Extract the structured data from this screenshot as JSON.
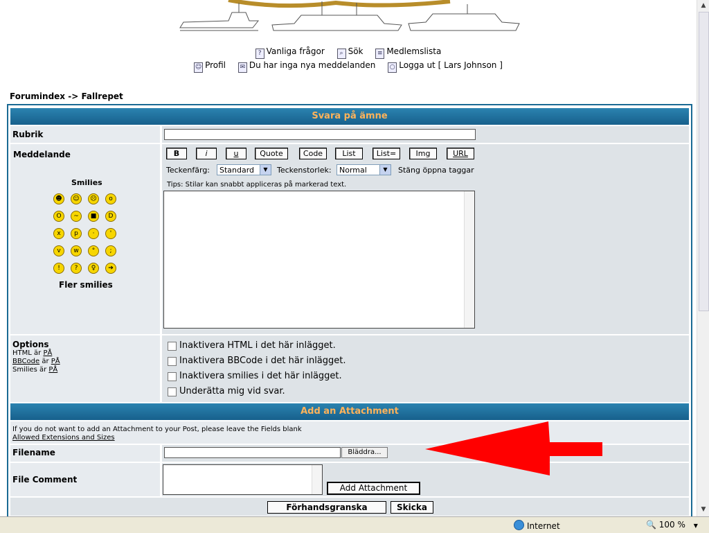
{
  "nav": {
    "faq": "Vanliga frågor",
    "search": "Sök",
    "members": "Medlemslista",
    "profile": "Profil",
    "messages": "Du har inga nya meddelanden",
    "logout": "Logga ut [ Lars Johnson ]"
  },
  "breadcrumb": {
    "index": "Forumindex",
    "sep": " -> ",
    "forum": "Fallrepet"
  },
  "reply": {
    "title": "Svara på ämne",
    "subject_label": "Rubrik",
    "message_label": "Meddelande",
    "smilies_label": "Smilies",
    "more_smilies": "Fler smilies",
    "bbcode": [
      "B",
      "i",
      "u",
      "Quote",
      "Code",
      "List",
      "List=",
      "Img",
      "URL"
    ],
    "font_color_label": "Teckenfärg:",
    "font_color_value": "Standard",
    "font_size_label": "Teckenstorlek:",
    "font_size_value": "Normal",
    "close_tags": "Stäng öppna taggar",
    "tips": "Tips: Stilar kan snabbt appliceras på markerad text.",
    "options_label": "Options",
    "opt_html_prefix": "HTML är ",
    "opt_bbcode_prefix": " är ",
    "opt_bbcode_link": "BBCode",
    "opt_smilies_prefix": "Smilies är ",
    "on": "PÅ",
    "options": [
      "Inaktivera HTML i det här inlägget.",
      "Inaktivera BBCode i det här inlägget.",
      "Inaktivera smilies i det här inlägget.",
      "Underätta mig vid svar."
    ]
  },
  "attachment": {
    "title": "Add an Attachment",
    "info": "If you do not want to add an Attachment to your Post, please leave the Fields blank",
    "ext_link": "Allowed Extensions and Sizes",
    "filename_label": "Filename",
    "browse": "Bläddra...",
    "comment_label": "File Comment",
    "add_button": "Add Attachment"
  },
  "buttons": {
    "preview": "Förhandsgranska",
    "submit": "Skicka"
  },
  "status": {
    "zone": "Internet",
    "zoom": "100 %"
  },
  "colors": {
    "catbar": "#1a6a94",
    "heading": "#ffb35a",
    "arrow": "#ff0000"
  }
}
